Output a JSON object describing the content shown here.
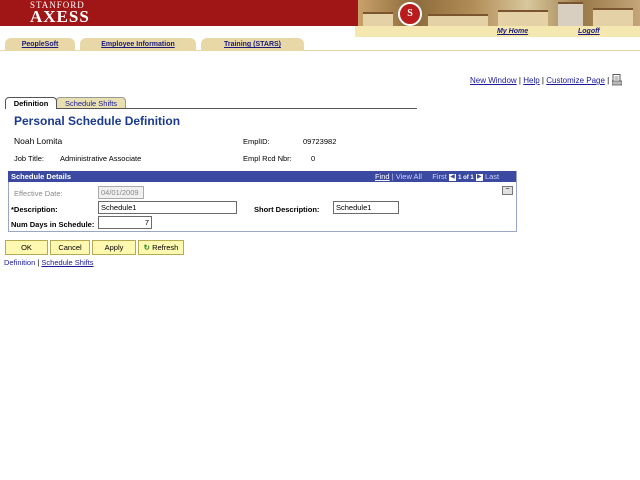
{
  "banner": {
    "logo_top": "STANFORD",
    "logo_main": "AXESS",
    "seal_letter": "S"
  },
  "toplinks": {
    "home": "My Home",
    "logoff": "Logoff"
  },
  "nav": {
    "items": [
      {
        "label": "PeopleSoft"
      },
      {
        "label": "Employee Information"
      },
      {
        "label": "Training (STARS)"
      }
    ]
  },
  "util": {
    "new_window": "New Window",
    "sep1": "|",
    "help": "Help",
    "sep2": "|",
    "customize": "Customize Page",
    "sep3": "|"
  },
  "tabs": {
    "definition": "Definition",
    "shifts": "Schedule Shifts"
  },
  "page": {
    "title": "Personal Schedule Definition",
    "employee_name": "Noah Lomita",
    "emplid_label": "EmplID:",
    "emplid": "09723982",
    "job_title_label": "Job Title:",
    "job_title": "Administrative Associate",
    "empl_rcd_label": "Empl Rcd Nbr:",
    "empl_rcd": "0"
  },
  "grid": {
    "title": "Schedule Details",
    "find": "Find",
    "sep": "|",
    "view_all": "View All",
    "first": "First",
    "position": "1 of 1",
    "last": "Last",
    "collapse": "−"
  },
  "form": {
    "effective_date_label": "Effective Date:",
    "effective_date": "04/01/2009",
    "description_label": "*Description:",
    "description": "Schedule1",
    "short_desc_label": "Short Description:",
    "short_desc": "Schedule1",
    "num_days_label": "Num Days in Schedule:",
    "num_days": "7"
  },
  "buttons": {
    "ok": "OK",
    "cancel": "Cancel",
    "apply": "Apply",
    "refresh": "Refresh"
  },
  "footer": {
    "definition": "Definition",
    "sep": "|",
    "shifts": "Schedule Shifts"
  },
  "colors": {
    "banner": "#a01515",
    "grid_header": "#3b4aa0",
    "title": "#1a3a8c",
    "button": "#fff8b0"
  }
}
